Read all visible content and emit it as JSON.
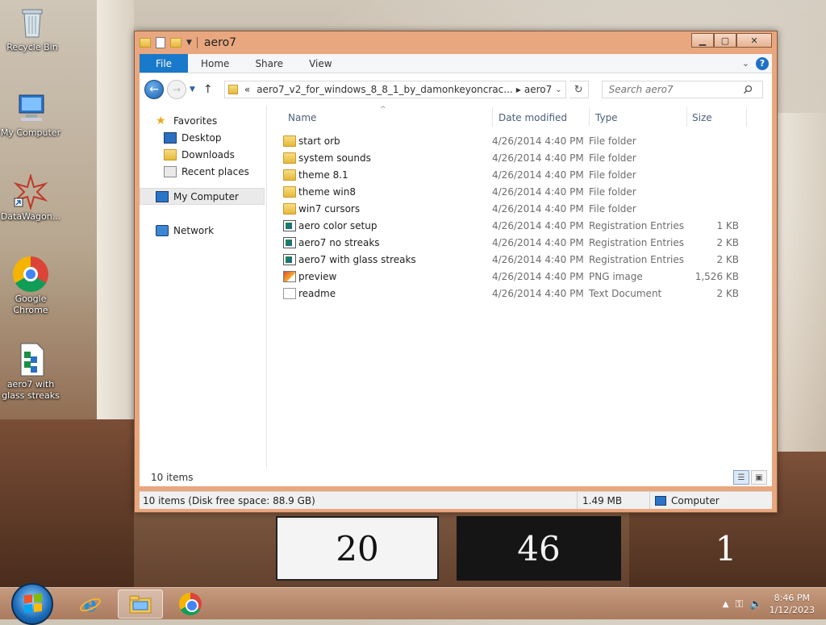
{
  "desktop": {
    "icons": [
      {
        "label": "Recycle Bin"
      },
      {
        "label": "My Computer"
      },
      {
        "label": "DataWagon..."
      },
      {
        "label": "Google Chrome"
      },
      {
        "label": "aero7 with glass streaks"
      }
    ],
    "wallpaper_clock": {
      "left": "20",
      "right": "46",
      "extra": "1"
    }
  },
  "window": {
    "title": "aero7",
    "ribbon": {
      "file": "File",
      "tabs": [
        "Home",
        "Share",
        "View"
      ],
      "help": "?"
    },
    "address": {
      "prefix": "«",
      "path": [
        "aero7_v2_for_windows_8_8_1_by_damonkeyoncrac...",
        "aero7"
      ]
    },
    "search": {
      "placeholder": "Search aero7"
    },
    "nav_pane": {
      "favorites": "Favorites",
      "favorites_items": [
        "Desktop",
        "Downloads",
        "Recent places"
      ],
      "computer": "My Computer",
      "network": "Network"
    },
    "columns": {
      "name": "Name",
      "date": "Date modified",
      "type": "Type",
      "size": "Size"
    },
    "files": [
      {
        "name": "start orb",
        "date": "4/26/2014 4:40 PM",
        "type": "File folder",
        "size": "",
        "icon": "folder-icon"
      },
      {
        "name": "system sounds",
        "date": "4/26/2014 4:40 PM",
        "type": "File folder",
        "size": "",
        "icon": "folder-icon"
      },
      {
        "name": "theme 8.1",
        "date": "4/26/2014 4:40 PM",
        "type": "File folder",
        "size": "",
        "icon": "folder-icon"
      },
      {
        "name": "theme win8",
        "date": "4/26/2014 4:40 PM",
        "type": "File folder",
        "size": "",
        "icon": "folder-icon"
      },
      {
        "name": "win7 cursors",
        "date": "4/26/2014 4:40 PM",
        "type": "File folder",
        "size": "",
        "icon": "folder-icon"
      },
      {
        "name": "aero color setup",
        "date": "4/26/2014 4:40 PM",
        "type": "Registration Entries",
        "size": "1 KB",
        "icon": "registry-file-icon"
      },
      {
        "name": "aero7 no streaks",
        "date": "4/26/2014 4:40 PM",
        "type": "Registration Entries",
        "size": "2 KB",
        "icon": "registry-file-icon"
      },
      {
        "name": "aero7 with glass streaks",
        "date": "4/26/2014 4:40 PM",
        "type": "Registration Entries",
        "size": "2 KB",
        "icon": "registry-file-icon"
      },
      {
        "name": "preview",
        "date": "4/26/2014 4:40 PM",
        "type": "PNG image",
        "size": "1,526 KB",
        "icon": "image-file-icon"
      },
      {
        "name": "readme",
        "date": "4/26/2014 4:40 PM",
        "type": "Text Document",
        "size": "2 KB",
        "icon": "text-file-icon"
      }
    ],
    "item_count": "10 items",
    "statusbar": {
      "summary": "10 items (Disk free space: 88.9 GB)",
      "size": "1.49 MB",
      "location": "Computer"
    }
  },
  "taskbar": {
    "time": "8:46 PM",
    "date": "1/12/2023"
  }
}
